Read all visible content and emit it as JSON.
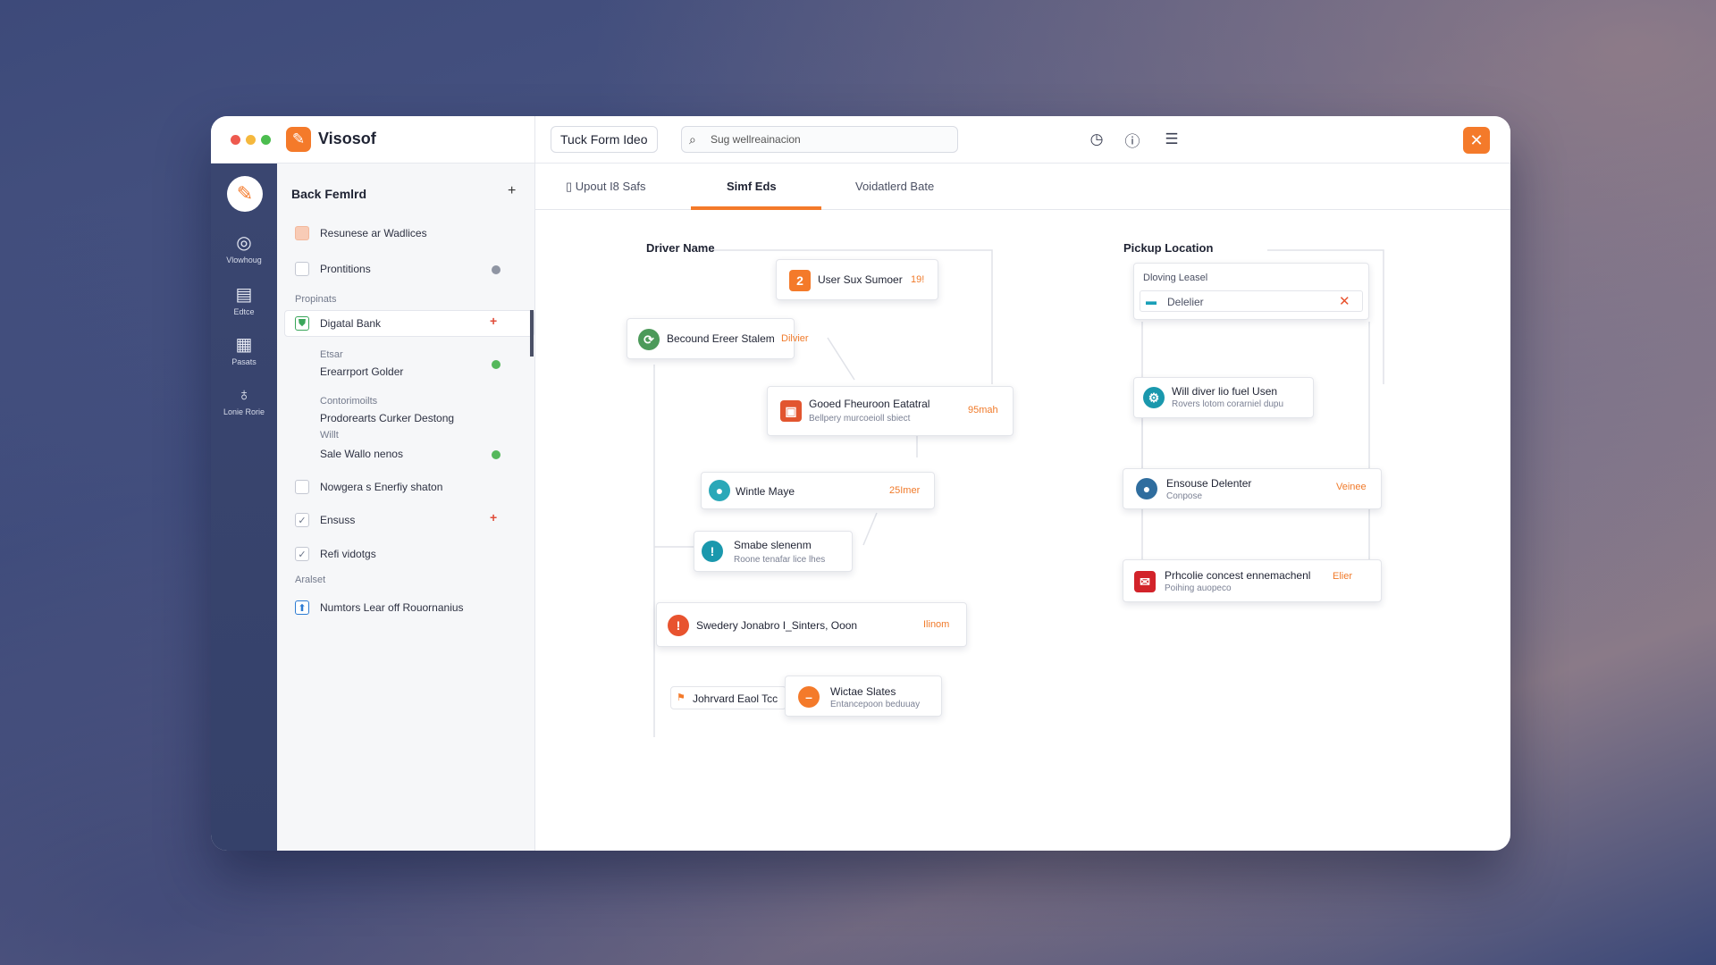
{
  "app": {
    "name": "Visosof",
    "open_tab": "Tuck Form Ideo"
  },
  "search": {
    "value": "Sug wellreainacion"
  },
  "colors": {
    "accent": "#f47a2a",
    "rail": "#3a4670"
  },
  "toolbar_icons": [
    "timer-icon",
    "info-icon",
    "stack-icon",
    "close-icon"
  ],
  "rail": {
    "items": [
      {
        "label": "Vlowhoug",
        "icon": "compass-icon"
      },
      {
        "label": "Edtce",
        "icon": "monitor-icon"
      },
      {
        "label": "Pasats",
        "icon": "calendar-icon"
      },
      {
        "label": "Lonie Rorie",
        "icon": "lightbulb-icon"
      }
    ]
  },
  "panel": {
    "title": "Back Femlrd",
    "items": [
      {
        "label": "Resunese ar Wadlices",
        "checked": false
      },
      {
        "label": "Prontitions",
        "checked": false
      },
      {
        "label": "Propinats"
      },
      {
        "label": "Digatal Bank",
        "selected": true
      },
      {
        "sub_label": "Etsar",
        "value": "Erearrport Golder"
      },
      {
        "sub_label": "Contorimoilts",
        "value": "Prodorearts Curker Destong"
      },
      {
        "sub_label": "Willt",
        "value": "Sale Wallo nenos"
      },
      {
        "label": "Nowgera s Enerfiy shaton",
        "checked": false
      },
      {
        "label": "Ensuss",
        "checked": true
      },
      {
        "label": "Refi vidotgs",
        "checked": true
      },
      {
        "label": "Aralset"
      },
      {
        "label": "Numtors Lear off Rouornanius"
      }
    ]
  },
  "tabs": [
    {
      "label": "Upout I8 Safs"
    },
    {
      "label": "Simf Eds",
      "active": true
    },
    {
      "label": "Voidatlerd Bate"
    }
  ],
  "columns": {
    "left_title": "Driver Name",
    "right_title": "Pickup Location"
  },
  "cards_left": [
    {
      "title": "User Sux Sumoer",
      "tag": "19!"
    },
    {
      "title": "Becound Ereer Stalem",
      "tag": "Dilvier"
    },
    {
      "title": "Gooed Fheuroon Eatatral",
      "sub": "Bellpery murcoeioll sbiect",
      "tag": "95mah"
    },
    {
      "title": "Wintle Maye",
      "tag": "25Imer"
    },
    {
      "title": "Smabe slenenm",
      "sub": "Roone tenafar lice lhes"
    },
    {
      "title": "Swedery Jonabro I_Sinters, Ooon",
      "tag": "Ilinom"
    },
    {
      "title": "Johrvard Eaol Tcc"
    },
    {
      "title": "Wictae Slates",
      "sub": "Entancepoon beduuay"
    }
  ],
  "cards_right": [
    {
      "title": "Dloving Leasel",
      "field": "Delelier"
    },
    {
      "title": "Will diver lio fuel Usen",
      "sub": "Rovers lotom corarniel dupu"
    },
    {
      "title": "Ensouse Delenter",
      "sub": "Conpose",
      "tag": "Veinee"
    },
    {
      "title": "Prhcolie concest ennemachenl",
      "sub": "Poihing auopeco",
      "tag": "Elier"
    }
  ]
}
